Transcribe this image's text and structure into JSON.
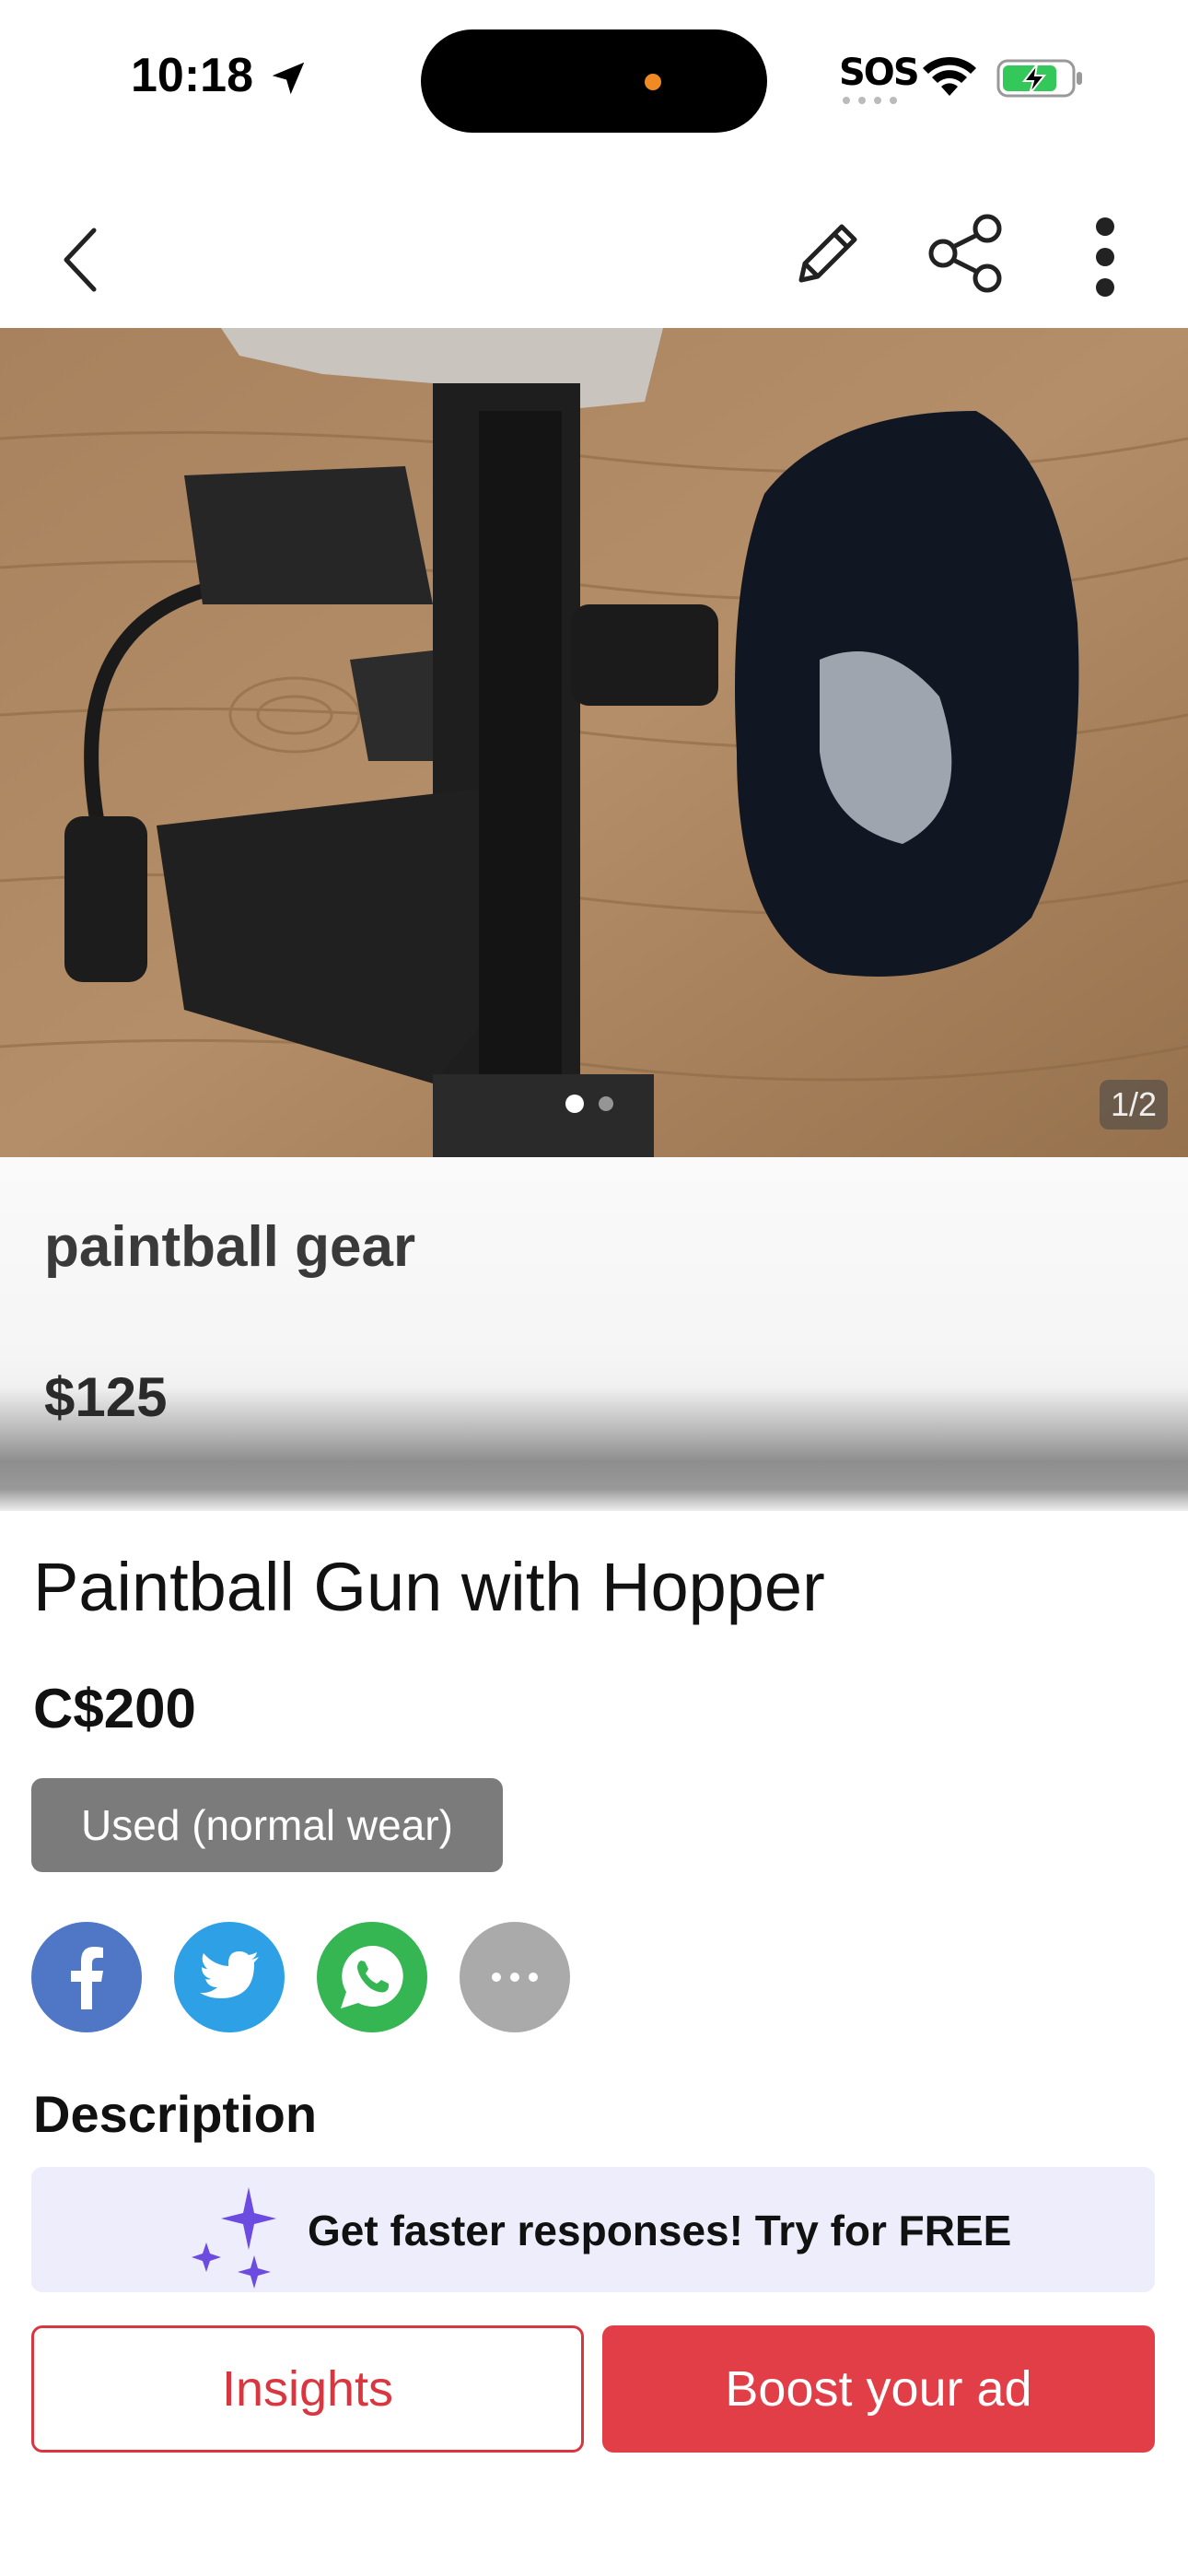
{
  "status_bar": {
    "time": "10:18",
    "carrier": "SOS",
    "icons": [
      "location-arrow-icon",
      "wifi-icon",
      "battery-charging-icon"
    ]
  },
  "nav": {
    "icons": [
      "back-chevron-icon",
      "edit-pencil-icon",
      "share-icon",
      "more-vertical-icon"
    ]
  },
  "photo": {
    "counter": "1/2",
    "pages": 2,
    "current_page": 1,
    "original_title": "paintball gear",
    "original_price": "$125"
  },
  "listing": {
    "title": "Paintball Gun with Hopper",
    "price": "C$200",
    "condition": "Used (normal wear)"
  },
  "share": {
    "buttons": [
      "facebook-icon",
      "twitter-icon",
      "whatsapp-icon",
      "more-horizontal-icon"
    ],
    "colors": {
      "facebook": "#4f77c6",
      "twitter": "#2ea0e6",
      "whatsapp": "#36b553",
      "more": "#aaaaaa"
    }
  },
  "description": {
    "heading": "Description"
  },
  "promo": {
    "text": "Get faster responses!  Try for FREE",
    "icon": "sparkles-icon"
  },
  "actions": {
    "insights_label": "Insights",
    "boost_label": "Boost your ad",
    "accent": "#e23e47"
  }
}
